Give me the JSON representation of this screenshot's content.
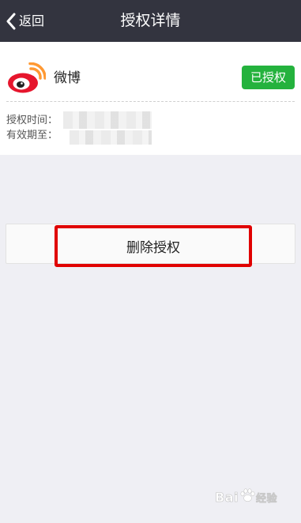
{
  "nav": {
    "back_label": "返回",
    "title": "授权详情"
  },
  "app": {
    "name": "微博",
    "status_badge": "已授权",
    "authorized_time_label": "授权时间：",
    "valid_until_label": "有效期至："
  },
  "actions": {
    "delete_label": "删除授权"
  },
  "watermark": {
    "brand": "Bai",
    "suffix": "经验"
  },
  "colors": {
    "nav_bg": "#33343f",
    "badge_green": "#24b23d",
    "highlight_red": "#e00000",
    "page_bg": "#efeff4",
    "weibo_red": "#e6162d",
    "weibo_orange": "#ff9933"
  }
}
